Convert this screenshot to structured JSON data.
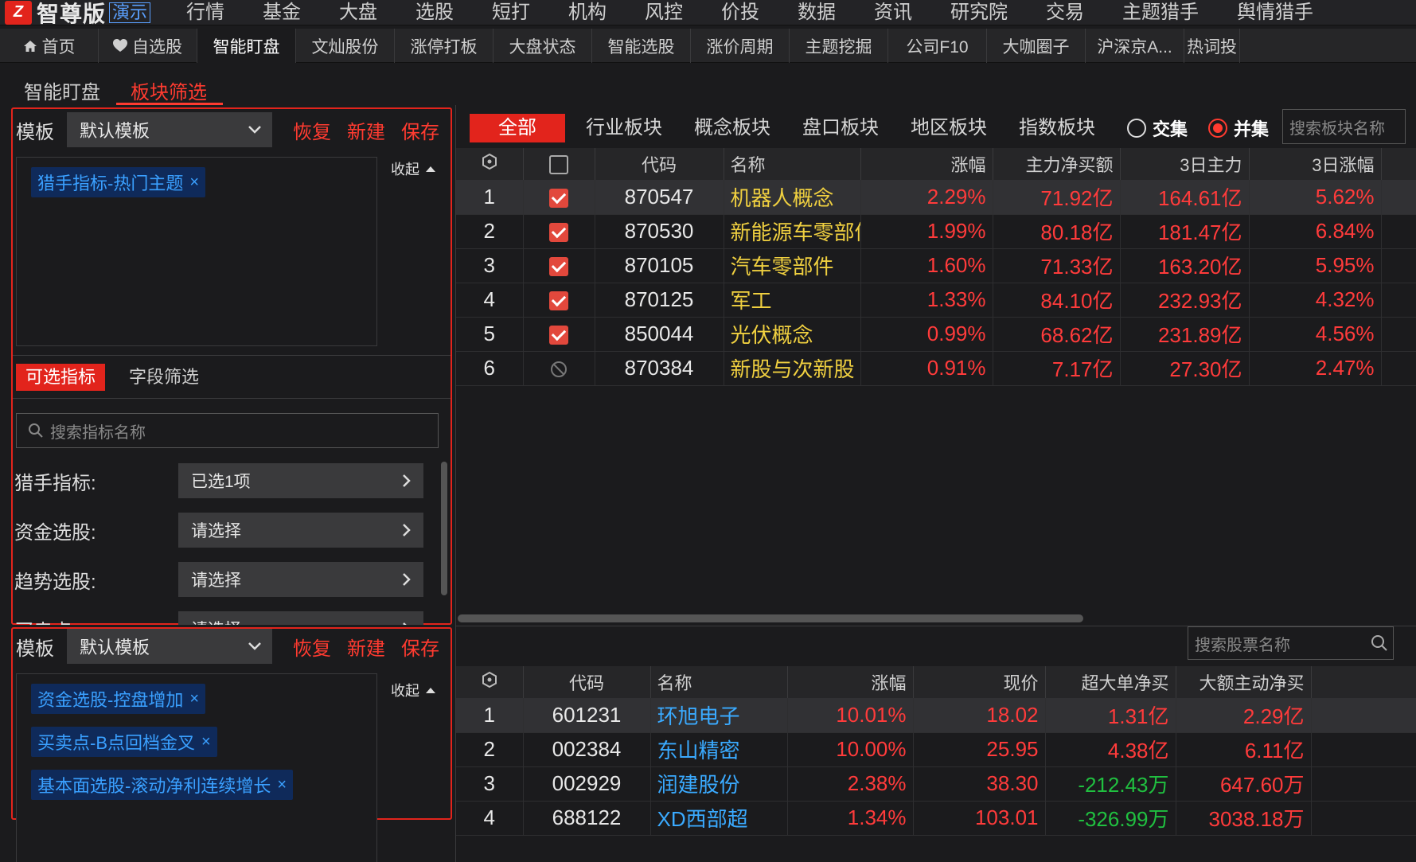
{
  "app": {
    "logo_text": "智尊版",
    "demo_label": "演示",
    "top_menu": [
      "行情",
      "基金",
      "大盘",
      "选股",
      "短打",
      "机构",
      "风控",
      "价投",
      "数据",
      "资讯",
      "研究院",
      "交易",
      "主题猎手",
      "舆情猎手"
    ]
  },
  "nav": {
    "items": [
      "首页",
      "自选股",
      "智能盯盘",
      "文灿股份",
      "涨停打板",
      "大盘状态",
      "智能选股",
      "涨价周期",
      "主题挖掘",
      "公司F10",
      "大咖圈子",
      "沪深京A...",
      "热词投"
    ]
  },
  "page_tabs": [
    "智能盯盘",
    "板块筛选"
  ],
  "left": {
    "template_label": "模板",
    "template_value": "默认模板",
    "actions": [
      "恢复",
      "新建",
      "保存"
    ],
    "collapse_label": "收起",
    "top_tags": [
      "猎手指标-热门主题"
    ],
    "sub_tabs": [
      "可选指标",
      "字段筛选"
    ],
    "search_placeholder": "搜索指标名称",
    "filters": [
      {
        "label": "猎手指标:",
        "value": "已选1项"
      },
      {
        "label": "资金选股:",
        "value": "请选择"
      },
      {
        "label": "趋势选股:",
        "value": "请选择"
      },
      {
        "label": "买卖点:",
        "value": "请选择"
      }
    ],
    "template2_label": "模板",
    "template2_value": "默认模板",
    "actions2": [
      "恢复",
      "新建",
      "保存"
    ],
    "collapse2_label": "收起",
    "bottom_tags": [
      "资金选股-控盘增加",
      "买卖点-B点回档金叉",
      "基本面选股-滚动净利连续增长"
    ]
  },
  "sector": {
    "tabs": [
      "全部",
      "行业板块",
      "概念板块",
      "盘口板块",
      "地区板块",
      "指数板块"
    ],
    "radio_intersect": "交集",
    "radio_union": "并集",
    "search_placeholder": "搜索板块名称",
    "columns": [
      "代码",
      "名称",
      "涨幅",
      "主力净买额",
      "3日主力",
      "3日涨幅"
    ],
    "rows": [
      {
        "idx": "1",
        "checked": true,
        "code": "870547",
        "name": "机器人概念",
        "chg": "2.29%",
        "net": "71.92亿",
        "net3": "164.61亿",
        "chg3": "5.62%"
      },
      {
        "idx": "2",
        "checked": true,
        "code": "870530",
        "name": "新能源车零部件",
        "chg": "1.99%",
        "net": "80.18亿",
        "net3": "181.47亿",
        "chg3": "6.84%"
      },
      {
        "idx": "3",
        "checked": true,
        "code": "870105",
        "name": "汽车零部件",
        "chg": "1.60%",
        "net": "71.33亿",
        "net3": "163.20亿",
        "chg3": "5.95%"
      },
      {
        "idx": "4",
        "checked": true,
        "code": "870125",
        "name": "军工",
        "chg": "1.33%",
        "net": "84.10亿",
        "net3": "232.93亿",
        "chg3": "4.32%"
      },
      {
        "idx": "5",
        "checked": true,
        "code": "850044",
        "name": "光伏概念",
        "chg": "0.99%",
        "net": "68.62亿",
        "net3": "231.89亿",
        "chg3": "4.56%"
      },
      {
        "idx": "6",
        "checked": false,
        "code": "870384",
        "name": "新股与次新股",
        "chg": "0.91%",
        "net": "7.17亿",
        "net3": "27.30亿",
        "chg3": "2.47%"
      }
    ]
  },
  "stocks": {
    "search_placeholder": "搜索股票名称",
    "columns": [
      "代码",
      "名称",
      "涨幅",
      "现价",
      "超大单净买",
      "大额主动净买"
    ],
    "rows": [
      {
        "idx": "1",
        "code": "601231",
        "name": "环旭电子",
        "chg": "10.01%",
        "price": "18.02",
        "super": "1.31亿",
        "big": "2.29亿",
        "super_neg": false
      },
      {
        "idx": "2",
        "code": "002384",
        "name": "东山精密",
        "chg": "10.00%",
        "price": "25.95",
        "super": "4.38亿",
        "big": "6.11亿",
        "super_neg": false
      },
      {
        "idx": "3",
        "code": "002929",
        "name": "润建股份",
        "chg": "2.38%",
        "price": "38.30",
        "super": "-212.43万",
        "big": "647.60万",
        "super_neg": true
      },
      {
        "idx": "4",
        "code": "688122",
        "name": "XD西部超",
        "chg": "1.34%",
        "price": "103.01",
        "super": "-326.99万",
        "big": "3038.18万",
        "super_neg": true
      }
    ]
  },
  "colors": {
    "accent_red": "#e2241c",
    "up_red": "#ff3b3b",
    "down_green": "#20c040",
    "tag_blue": "#3aa0ff"
  }
}
